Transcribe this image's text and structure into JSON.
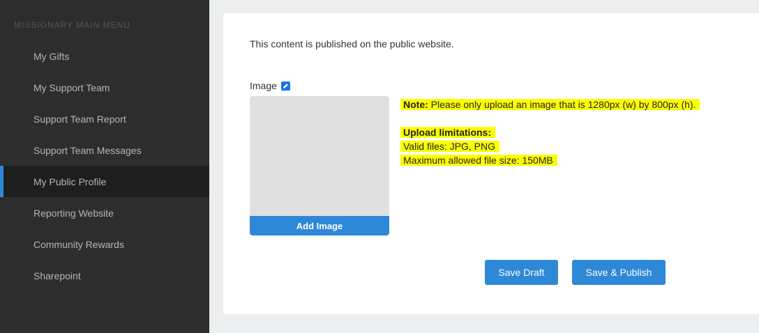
{
  "sidebar": {
    "heading": "MISSIONARY MAIN MENU",
    "items": [
      {
        "label": "My Gifts"
      },
      {
        "label": "My Support Team"
      },
      {
        "label": "Support Team Report"
      },
      {
        "label": "Support Team Messages"
      },
      {
        "label": "My Public Profile",
        "active": true
      },
      {
        "label": "Reporting Website"
      },
      {
        "label": "Community Rewards"
      },
      {
        "label": "Sharepoint"
      }
    ]
  },
  "main": {
    "intro": "This content is published on the public website.",
    "image_label": "Image",
    "edit_icon": "edit-pencil-icon",
    "add_image_label": "Add Image",
    "note_prefix": "Note:",
    "note_text": " Please only upload an image that is 1280px (w) by 800px (h).",
    "limitations_title": "Upload limitations:",
    "valid_files": "Valid files: JPG, PNG",
    "max_size": "Maximum allowed file size: 150MB",
    "save_draft_label": "Save Draft",
    "save_publish_label": "Save & Publish"
  },
  "colors": {
    "accent": "#2e88d8",
    "highlight": "#fbff00",
    "sidebar_bg": "#2d2d2d"
  }
}
